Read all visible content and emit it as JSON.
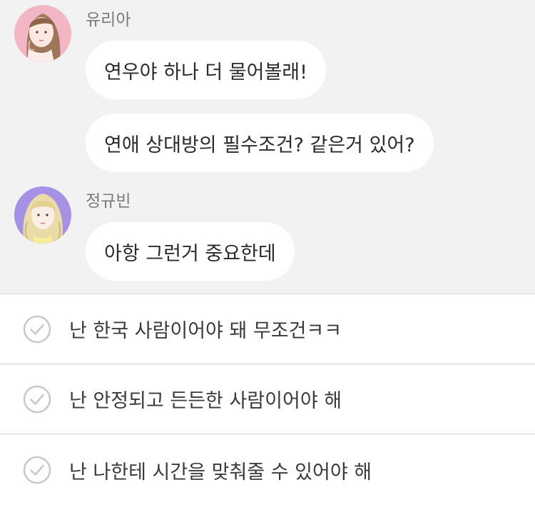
{
  "chat": {
    "messages": [
      {
        "sender": "유리아",
        "texts": [
          "연우야 하나 더 물어볼래!",
          "연애 상대방의 필수조건? 같은거 있어?"
        ]
      },
      {
        "sender": "정규빈",
        "texts": [
          "아항 그런거 중요한데"
        ]
      }
    ]
  },
  "options": [
    {
      "label": "난 한국 사람이어야 돼 무조건ㅋㅋ"
    },
    {
      "label": "난 안정되고 든든한 사람이어야 해"
    },
    {
      "label": "난 나한테 시간을 맞춰줄 수 있어야 해"
    }
  ],
  "colors": {
    "chat_background": "#f2f2f2",
    "bubble": "#ffffff",
    "avatar1_background": "#f3b6c4",
    "avatar2_background": "#a592e6",
    "check_outline": "#c8c8c8",
    "divider": "#d0d0d0"
  },
  "icons": {
    "option_check": "check-circle-icon"
  }
}
